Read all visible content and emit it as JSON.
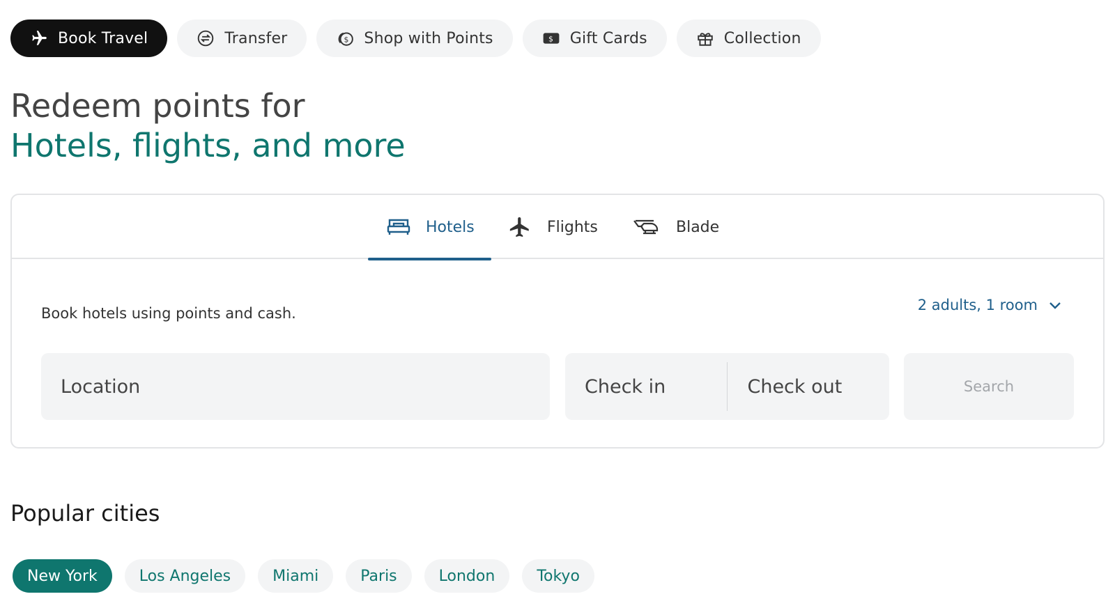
{
  "top_nav": [
    {
      "label": "Book Travel",
      "icon": "airplane-icon",
      "active": true
    },
    {
      "label": "Transfer",
      "icon": "transfer-icon",
      "active": false
    },
    {
      "label": "Shop with Points",
      "icon": "coins-icon",
      "active": false
    },
    {
      "label": "Gift Cards",
      "icon": "gift-card-icon",
      "active": false
    },
    {
      "label": "Collection",
      "icon": "gift-icon",
      "active": false
    }
  ],
  "heading": {
    "line1": "Redeem points for",
    "line2": "Hotels, flights, and more"
  },
  "booking_tabs": [
    {
      "label": "Hotels",
      "icon": "bed-icon",
      "active": true
    },
    {
      "label": "Flights",
      "icon": "airplane-icon",
      "active": false
    },
    {
      "label": "Blade",
      "icon": "helicopter-icon",
      "active": false
    }
  ],
  "hotels": {
    "description": "Book hotels using points and cash.",
    "guests": "2 adults, 1 room",
    "location_placeholder": "Location",
    "check_in": "Check in",
    "check_out": "Check out",
    "search_label": "Search"
  },
  "popular": {
    "title": "Popular cities",
    "cities": [
      "New York",
      "Los Angeles",
      "Miami",
      "Paris",
      "London",
      "Tokyo"
    ],
    "selected": "New York"
  },
  "colors": {
    "accent_teal": "#0f766e",
    "tab_blue": "#1f5f8b",
    "active_nav": "#111111",
    "chip_bg": "#f3f4f5"
  }
}
